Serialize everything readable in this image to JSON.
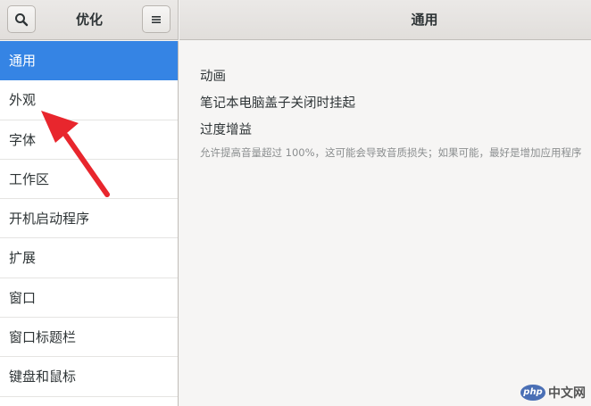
{
  "header": {
    "left_title": "优化",
    "right_title": "通用"
  },
  "sidebar": {
    "items": [
      {
        "label": "通用"
      },
      {
        "label": "外观"
      },
      {
        "label": "字体"
      },
      {
        "label": "工作区"
      },
      {
        "label": "开机启动程序"
      },
      {
        "label": "扩展"
      },
      {
        "label": "窗口"
      },
      {
        "label": "窗口标题栏"
      },
      {
        "label": "键盘和鼠标"
      }
    ],
    "selected_index": 0
  },
  "content": {
    "animation_label": "动画",
    "lid_label": "笔记本电脑盖子关闭时挂起",
    "overamp_label": "过度增益",
    "overamp_desc": "允许提高音量超过 100%，这可能会导致音质损失；如果可能，最好是增加应用程序"
  },
  "watermark": {
    "logo": "php",
    "text": "中文网"
  },
  "colors": {
    "accent": "#3584e4",
    "annotation": "#e8262d"
  },
  "icons": {
    "search": "search-icon",
    "menu": "hamburger-menu-icon"
  }
}
